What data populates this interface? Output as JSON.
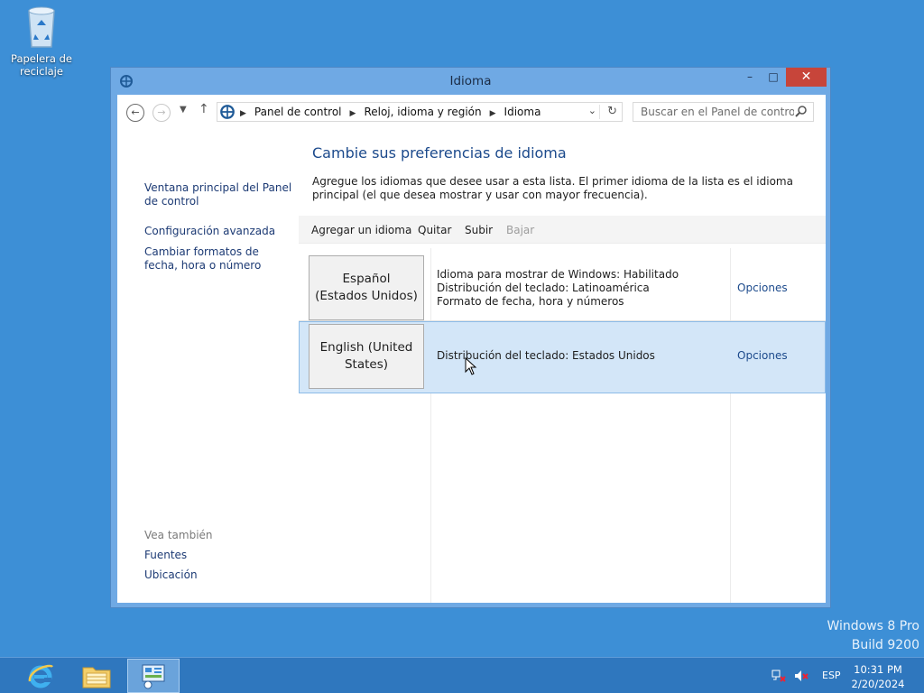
{
  "desktop": {
    "recycle_bin_label": "Papelera de reciclaje",
    "watermark_line1": "Windows 8 Pro",
    "watermark_line2": "Build 9200"
  },
  "window": {
    "title": "Idioma",
    "controls": {
      "minimize": "–",
      "maximize": "□",
      "close": "✕"
    }
  },
  "address_bar": {
    "breadcrumbs": [
      "Panel de control",
      "Reloj, idioma y región",
      "Idioma"
    ],
    "search_placeholder": "Buscar en el Panel de control"
  },
  "left_nav": {
    "links": [
      "Ventana principal del Panel de control",
      "Configuración avanzada",
      "Cambiar formatos de fecha, hora o número"
    ],
    "see_also_heading": "Vea también",
    "see_also_links": [
      "Fuentes",
      "Ubicación"
    ]
  },
  "main": {
    "heading": "Cambie sus preferencias de idioma",
    "description": "Agregue los idiomas que desee usar a esta lista. El primer idioma de la lista es el idioma principal (el que desea mostrar y usar con mayor frecuencia).",
    "toolbar": {
      "add": "Agregar un idioma",
      "remove": "Quitar",
      "up": "Subir",
      "down": "Bajar"
    },
    "languages": [
      {
        "name": "Español (Estados Unidos)",
        "details": [
          "Idioma para mostrar de Windows: Habilitado",
          "Distribución del teclado: Latinoamérica",
          "Formato de fecha, hora y números"
        ],
        "options": "Opciones",
        "selected": false
      },
      {
        "name": "English (United States)",
        "details": [
          "Distribución del teclado: Estados Unidos"
        ],
        "options": "Opciones",
        "selected": true
      }
    ]
  },
  "taskbar": {
    "apps": [
      "internet-explorer",
      "file-explorer",
      "control-panel"
    ],
    "language": "ESP",
    "time": "10:31 PM",
    "date": "2/20/2024"
  },
  "colors": {
    "desktop": "#3d8fd6",
    "taskbar": "#2f77be",
    "link": "#1c3a74",
    "heading": "#1c4a8c",
    "selection": "#d3e6f8",
    "close_button": "#c7453a"
  }
}
